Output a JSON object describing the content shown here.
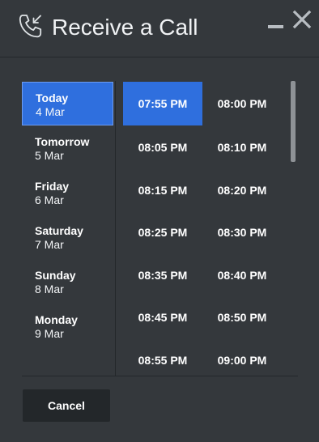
{
  "window": {
    "title": "Receive a Call"
  },
  "icons": {
    "phone": "incoming-call-icon",
    "minimize": "minimize-icon",
    "close": "close-icon"
  },
  "colors": {
    "background": "#34383c",
    "selected": "#2f6fde",
    "button": "#23272a",
    "scrollbar": "#8e9296"
  },
  "days": [
    {
      "name": "Today",
      "date": "4 Mar",
      "selected": true
    },
    {
      "name": "Tomorrow",
      "date": "5 Mar",
      "selected": false
    },
    {
      "name": "Friday",
      "date": "6 Mar",
      "selected": false
    },
    {
      "name": "Saturday",
      "date": "7 Mar",
      "selected": false
    },
    {
      "name": "Sunday",
      "date": "8 Mar",
      "selected": false
    },
    {
      "name": "Monday",
      "date": "9 Mar",
      "selected": false
    }
  ],
  "times": [
    {
      "label": "07:55 PM",
      "selected": true
    },
    {
      "label": "08:00 PM",
      "selected": false
    },
    {
      "label": "08:05 PM",
      "selected": false
    },
    {
      "label": "08:10 PM",
      "selected": false
    },
    {
      "label": "08:15 PM",
      "selected": false
    },
    {
      "label": "08:20 PM",
      "selected": false
    },
    {
      "label": "08:25 PM",
      "selected": false
    },
    {
      "label": "08:30 PM",
      "selected": false
    },
    {
      "label": "08:35 PM",
      "selected": false
    },
    {
      "label": "08:40 PM",
      "selected": false
    },
    {
      "label": "08:45 PM",
      "selected": false
    },
    {
      "label": "08:50 PM",
      "selected": false
    },
    {
      "label": "08:55 PM",
      "selected": false
    },
    {
      "label": "09:00 PM",
      "selected": false
    }
  ],
  "footer": {
    "cancel_label": "Cancel"
  }
}
